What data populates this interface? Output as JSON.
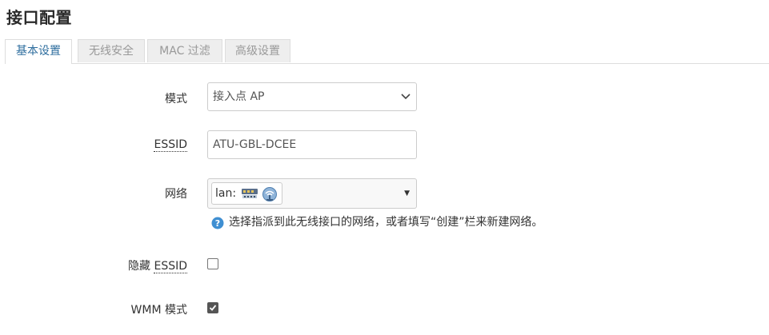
{
  "page": {
    "title": "接口配置"
  },
  "tabs": [
    {
      "label": "基本设置",
      "active": true
    },
    {
      "label": "无线安全",
      "active": false
    },
    {
      "label": "MAC 过滤",
      "active": false
    },
    {
      "label": "高级设置",
      "active": false
    }
  ],
  "form": {
    "mode": {
      "label": "模式",
      "value": "接入点 AP"
    },
    "essid": {
      "label": "ESSID",
      "value": "ATU-GBL-DCEE"
    },
    "network": {
      "label": "网络",
      "selected": "lan:",
      "icons": [
        "network-switch-icon",
        "wireless-icon"
      ],
      "help": "选择指派到此无线接口的网络，或者填写“创建”栏来新建网络。"
    },
    "hidden_essid": {
      "label_prefix": "隐藏 ",
      "label_abbr": "ESSID",
      "checked": false
    },
    "wmm": {
      "label": "WMM 模式",
      "checked": true
    }
  },
  "colors": {
    "accent": "#2d6d9e",
    "tab_bg": "#eeeeee",
    "border": "#dddddd",
    "checkbox_checked": "#555555"
  }
}
